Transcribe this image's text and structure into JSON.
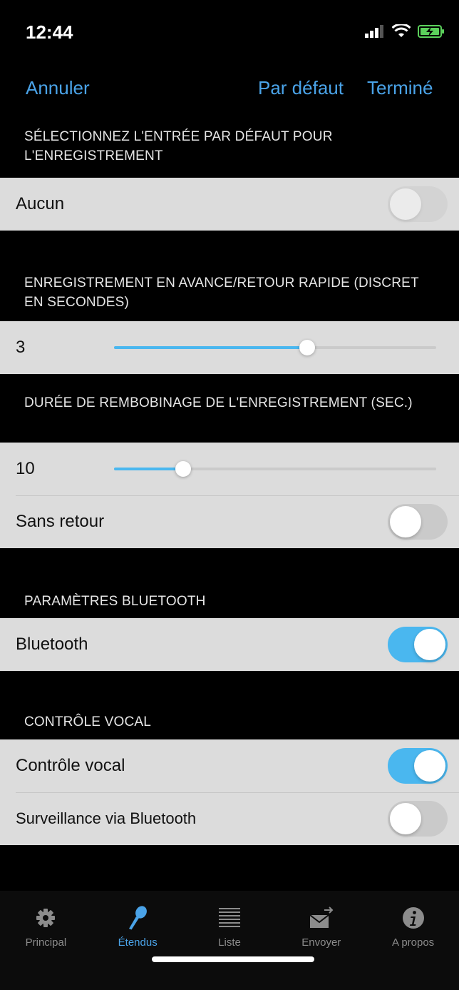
{
  "status": {
    "time": "12:44"
  },
  "nav": {
    "cancel": "Annuler",
    "defaults": "Par défaut",
    "done": "Terminé"
  },
  "sections": {
    "input_title": "SÉLECTIONNEZ L'ENTRÉE PAR DÉFAUT POUR L'ENREGISTREMENT",
    "input_value": "Aucun",
    "skip_title": "ENREGISTREMENT EN AVANCE/RETOUR RAPIDE (DISCRET EN SECONDES)",
    "skip_value": "3",
    "skip_slider_fraction": 0.6,
    "rewind_title": "DURÉE DE REMBOBINAGE DE L'ENREGISTREMENT (SEC.)",
    "rewind_value": "10",
    "rewind_slider_fraction": 0.215,
    "no_rewind_label": "Sans retour",
    "bluetooth_title": "PARAMÈTRES BLUETOOTH",
    "bluetooth_label": "Bluetooth",
    "voice_title": "CONTRÔLE VOCAL",
    "voice_label": "Contrôle vocal",
    "monitor_label": "Surveillance via Bluetooth"
  },
  "toggles": {
    "input": false,
    "no_rewind": false,
    "bluetooth": true,
    "voice": true,
    "monitor": false
  },
  "tabs": [
    {
      "label": "Principal",
      "icon": "gear-icon"
    },
    {
      "label": "Étendus",
      "icon": "microphone-icon",
      "active": true
    },
    {
      "label": "Liste",
      "icon": "list-icon"
    },
    {
      "label": "Envoyer",
      "icon": "send-mail-icon"
    },
    {
      "label": "A propos",
      "icon": "info-icon"
    }
  ],
  "colors": {
    "accent": "#4aa3e8",
    "toggle_on": "#4ab7ef",
    "background": "#000000",
    "cell": "#dcdcdc"
  }
}
